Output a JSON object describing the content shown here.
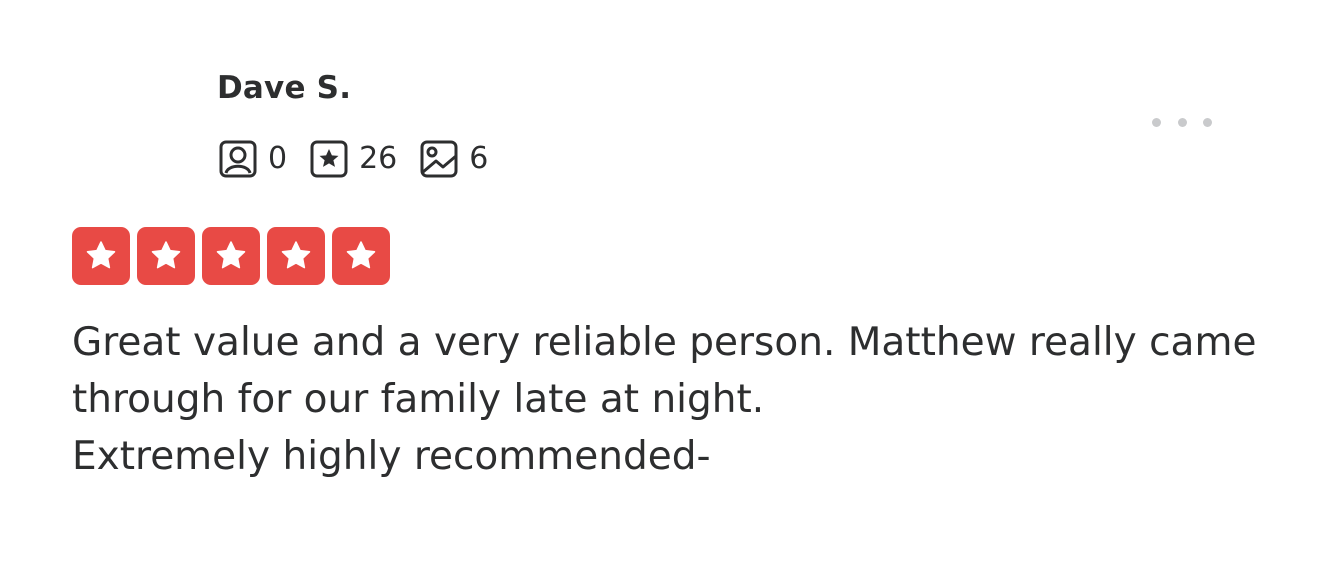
{
  "review": {
    "user": {
      "name": "Dave S.",
      "stats": [
        {
          "icon": "friends-icon",
          "value": "0"
        },
        {
          "icon": "reviews-icon",
          "value": "26"
        },
        {
          "icon": "photos-icon",
          "value": "6"
        }
      ]
    },
    "rating": {
      "value": 5,
      "max": 5,
      "star_color": "#e84a45"
    },
    "text_lines": [
      "Great value and a very reliable person. Matthew really came",
      "through for our family late at night.",
      "Extremely highly recommended-"
    ]
  },
  "colors": {
    "text": "#2d2e2f",
    "icon": "#2d2e2f",
    "more_dots": "#c9cacc",
    "star_bg": "#e84a45"
  }
}
